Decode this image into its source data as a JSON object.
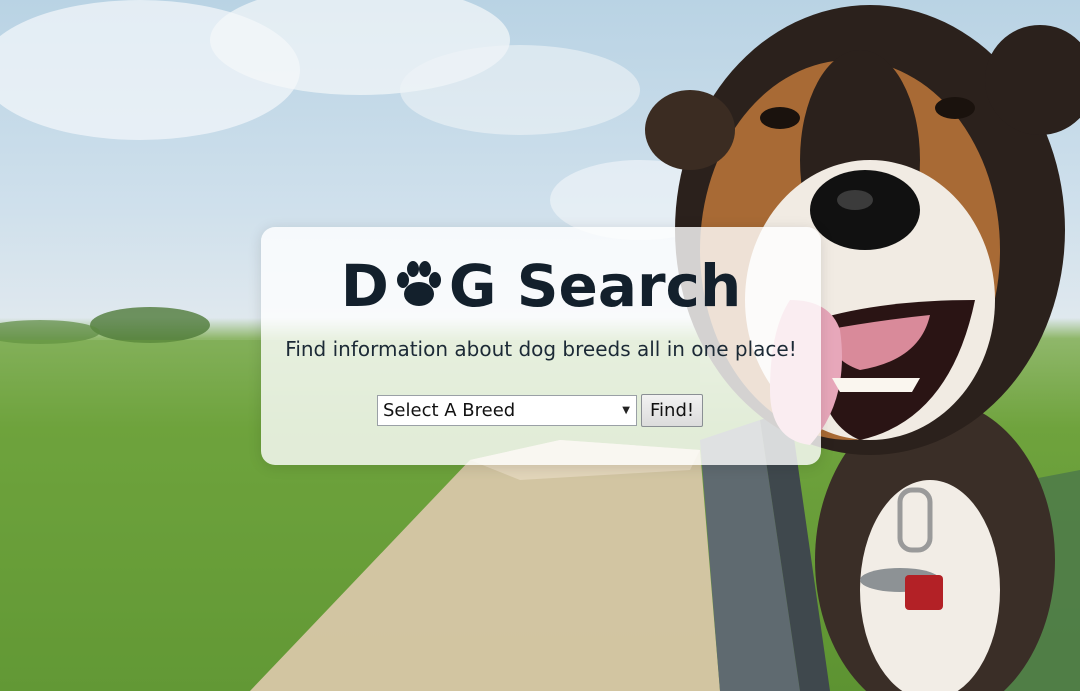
{
  "hero": {
    "title_prefix": "D",
    "title_suffix": "G Search",
    "tagline": "Find information about dog breeds all in one place!"
  },
  "search": {
    "select_value": "Select A Breed",
    "button_label": "Find!"
  },
  "icons": {
    "logo_glyph": "paw-icon",
    "select_glyph": "chevron-down-icon"
  },
  "colors": {
    "title": "#13202c",
    "card": "#ffffff"
  }
}
